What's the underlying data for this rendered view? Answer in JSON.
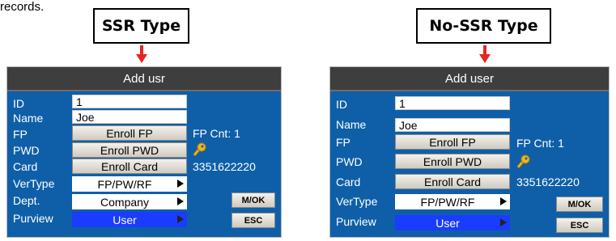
{
  "caption": "records.",
  "left": {
    "type_label": "SSR Type",
    "title": "Add usr",
    "labels": {
      "id": "ID",
      "name": "Name",
      "fp": "FP",
      "pwd": "PWD",
      "card": "Card",
      "vertype": "VerType",
      "dept": "Dept.",
      "purview": "Purview"
    },
    "values": {
      "id": "1",
      "name": "Joe",
      "fp_cnt": "FP Cnt: 1",
      "card_no": "3351622220"
    },
    "buttons": {
      "enroll_fp": "Enroll FP",
      "enroll_pwd": "Enroll PWD",
      "enroll_card": "Enroll Card",
      "mok": "M/OK",
      "esc": "ESC"
    },
    "selects": {
      "vertype": "FP/PW/RF",
      "dept": "Company",
      "purview": "User"
    }
  },
  "right": {
    "type_label": "No-SSR Type",
    "title": "Add user",
    "labels": {
      "id": "ID",
      "name": "Name",
      "fp": "FP",
      "pwd": "PWD",
      "card": "Card",
      "vertype": "VerType",
      "purview": "Purview"
    },
    "values": {
      "id": "1",
      "name": "Joe",
      "fp_cnt": "FP Cnt:  1",
      "card_no": "3351622220"
    },
    "buttons": {
      "enroll_fp": "Enroll FP",
      "enroll_pwd": "Enroll PWD",
      "enroll_card": "Enroll Card",
      "mok": "M/OK",
      "esc": "ESC"
    },
    "selects": {
      "vertype": "FP/PW/RF",
      "purview": "User"
    }
  },
  "colors": {
    "screen_bg": "#0f5fa8",
    "title_bar": "#3e3e3e",
    "highlight": "#1a3cff",
    "arrow": "#e8251f",
    "key": "#f2b51c"
  },
  "icons": {
    "key": "key-icon",
    "arrow": "arrow-down-icon",
    "triangle": "triangle-right-icon"
  }
}
